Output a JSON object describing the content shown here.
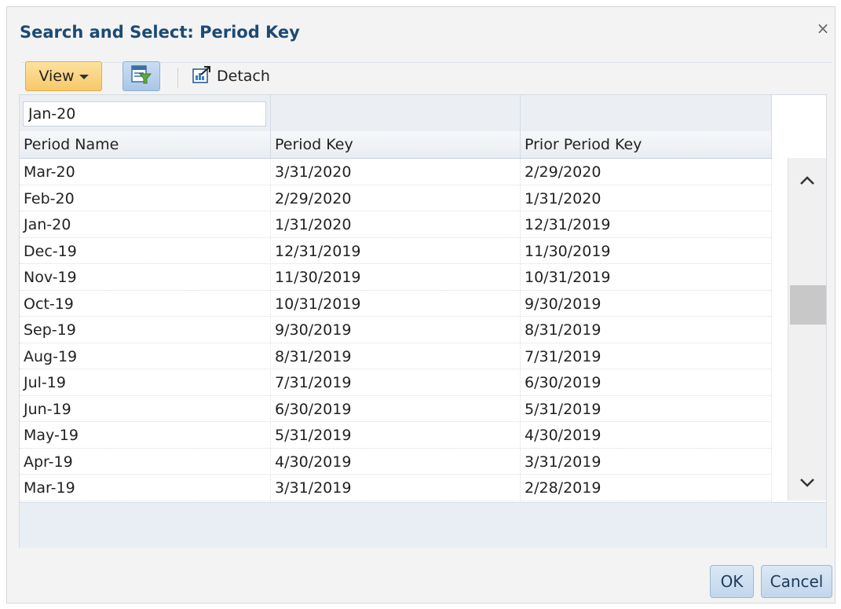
{
  "dialog": {
    "title": "Search and Select: Period Key",
    "close_glyph": "×"
  },
  "toolbar": {
    "view_label": "View",
    "filter_icon": "query-by-example-icon",
    "detach_label": "Detach",
    "detach_icon": "detach-icon"
  },
  "filter": {
    "period_name_value": "Jan-20"
  },
  "table": {
    "columns": [
      "Period Name",
      "Period Key",
      "Prior Period Key"
    ],
    "rows": [
      [
        "Mar-20",
        "3/31/2020",
        "2/29/2020"
      ],
      [
        "Feb-20",
        "2/29/2020",
        "1/31/2020"
      ],
      [
        "Jan-20",
        "1/31/2020",
        "12/31/2019"
      ],
      [
        "Dec-19",
        "12/31/2019",
        "11/30/2019"
      ],
      [
        "Nov-19",
        "11/30/2019",
        "10/31/2019"
      ],
      [
        "Oct-19",
        "10/31/2019",
        "9/30/2019"
      ],
      [
        "Sep-19",
        "9/30/2019",
        "8/31/2019"
      ],
      [
        "Aug-19",
        "8/31/2019",
        "7/31/2019"
      ],
      [
        "Jul-19",
        "7/31/2019",
        "6/30/2019"
      ],
      [
        "Jun-19",
        "6/30/2019",
        "5/31/2019"
      ],
      [
        "May-19",
        "5/31/2019",
        "4/30/2019"
      ],
      [
        "Apr-19",
        "4/30/2019",
        "3/31/2019"
      ],
      [
        "Mar-19",
        "3/31/2019",
        "2/28/2019"
      ]
    ]
  },
  "buttons": {
    "ok_label": "OK",
    "cancel_label": "Cancel"
  },
  "colors": {
    "title": "#1c4a74",
    "view_button": "#f7c86a",
    "action_button": "#c2d6ec"
  }
}
